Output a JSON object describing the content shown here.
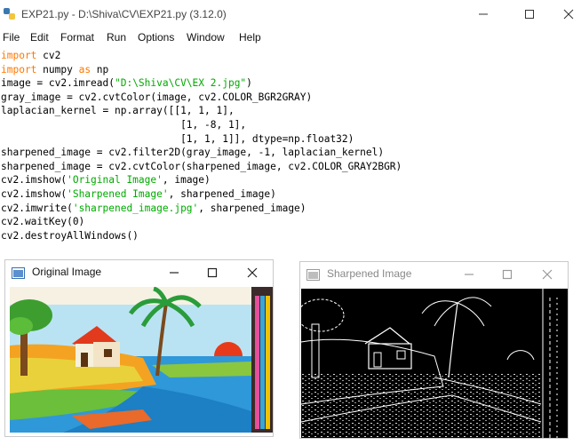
{
  "editor_window": {
    "title": "EXP21.py - D:\\Shiva\\CV\\EXP21.py (3.12.0)",
    "menu": [
      "File",
      "Edit",
      "Format",
      "Run",
      "Options",
      "Window",
      "Help"
    ]
  },
  "code_lines": [
    [
      {
        "t": "import",
        "c": "kw"
      },
      {
        "t": " cv2",
        "c": ""
      }
    ],
    [
      {
        "t": "import",
        "c": "kw"
      },
      {
        "t": " numpy ",
        "c": ""
      },
      {
        "t": "as",
        "c": "kw"
      },
      {
        "t": " np",
        "c": ""
      }
    ],
    [
      {
        "t": "image = cv2.imread(",
        "c": ""
      },
      {
        "t": "\"D:\\Shiva\\CV\\EX 2.jpg\"",
        "c": "st"
      },
      {
        "t": ")",
        "c": ""
      }
    ],
    [
      {
        "t": "gray_image = cv2.cvtColor(image, cv2.COLOR_BGR2GRAY)",
        "c": ""
      }
    ],
    [
      {
        "t": "laplacian_kernel = np.array([[1, 1, 1],",
        "c": ""
      }
    ],
    [
      {
        "t": "                              [1, -8, 1],",
        "c": ""
      }
    ],
    [
      {
        "t": "                              [1, 1, 1]], dtype=np.float32)",
        "c": ""
      }
    ],
    [
      {
        "t": "sharpened_image = cv2.filter2D(gray_image, -1, laplacian_kernel)",
        "c": ""
      }
    ],
    [
      {
        "t": "sharpened_image = cv2.cvtColor(sharpened_image, cv2.COLOR_GRAY2BGR)",
        "c": ""
      }
    ],
    [
      {
        "t": "cv2.imshow(",
        "c": ""
      },
      {
        "t": "'Original Image'",
        "c": "st"
      },
      {
        "t": ", image)",
        "c": ""
      }
    ],
    [
      {
        "t": "cv2.imshow(",
        "c": ""
      },
      {
        "t": "'Sharpened Image'",
        "c": "st"
      },
      {
        "t": ", sharpened_image)",
        "c": ""
      }
    ],
    [
      {
        "t": "cv2.imwrite(",
        "c": ""
      },
      {
        "t": "'sharpened_image.jpg'",
        "c": "st"
      },
      {
        "t": ", sharpened_image)",
        "c": ""
      }
    ],
    [
      {
        "t": "cv2.waitKey(0)",
        "c": ""
      }
    ],
    [
      {
        "t": "cv2.destroyAllWindows()",
        "c": ""
      }
    ]
  ],
  "original_window": {
    "title": "Original Image"
  },
  "sharpened_window": {
    "title": "Sharpened Image"
  },
  "colors": {
    "keyword": "#ff7700",
    "string": "#00aa00"
  }
}
